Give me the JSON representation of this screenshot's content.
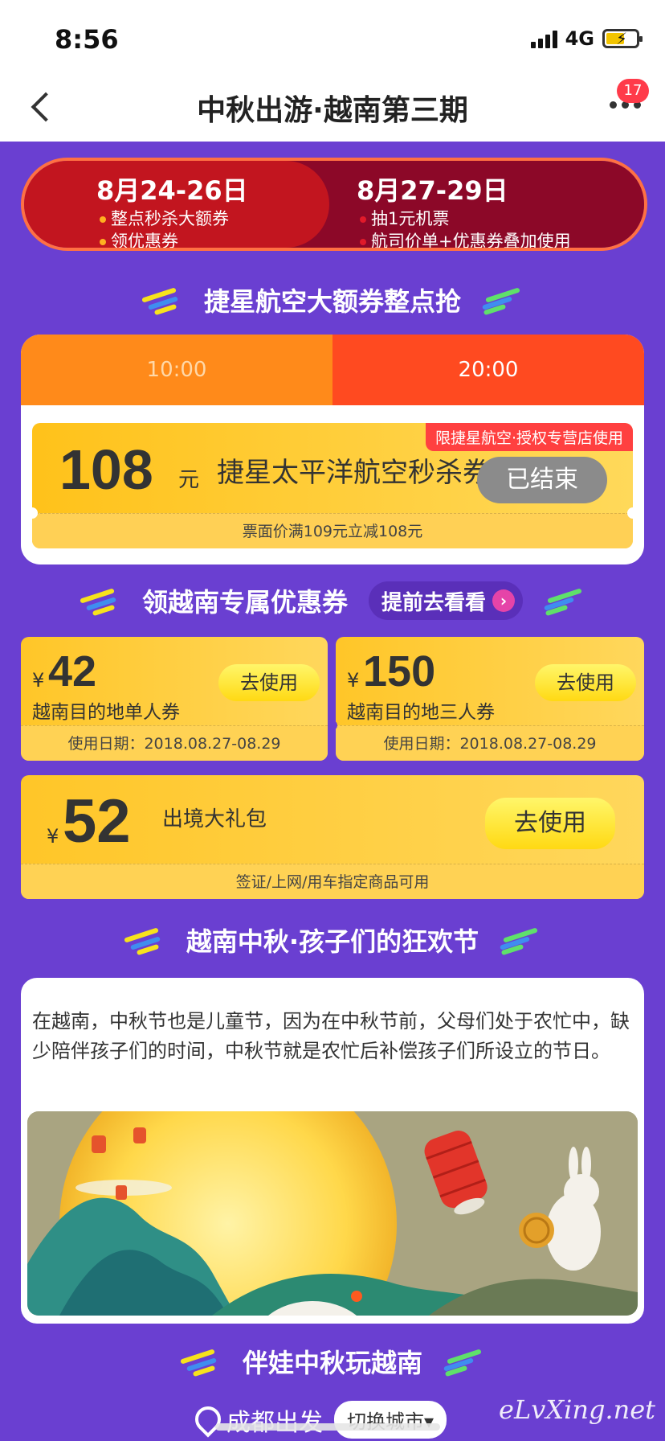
{
  "status_bar": {
    "time": "8:56",
    "network": "4G"
  },
  "nav": {
    "title": "中秋出游·越南第三期",
    "badge_count": "17"
  },
  "phases": [
    {
      "date": "8月24-26日",
      "items": [
        "整点秒杀大额券",
        "领优惠券"
      ],
      "dot_color": "#ffb020"
    },
    {
      "date": "8月27-29日",
      "items": [
        "抽1元机票",
        "航司价单+优惠券叠加使用"
      ],
      "dot_color": "#e11a2a"
    }
  ],
  "section1": {
    "title": "捷星航空大额券整点抢"
  },
  "flash_sale": {
    "tabs": [
      "10:00",
      "20:00"
    ],
    "coupon": {
      "amount": "108",
      "unit": "元",
      "name": "捷星太平洋航空秒杀券",
      "tag": "限捷星航空·授权专营店使用",
      "status_button": "已结束",
      "condition": "票面价满109元立减108元"
    }
  },
  "section2": {
    "title": "领越南专属优惠券",
    "preview_button": "提前去看看"
  },
  "coupons": [
    {
      "currency": "¥",
      "amount": "42",
      "name": "越南目的地单人券",
      "button": "去使用",
      "date": "使用日期：2018.08.27-08.29"
    },
    {
      "currency": "¥",
      "amount": "150",
      "name": "越南目的地三人券",
      "button": "去使用",
      "date": "使用日期：2018.08.27-08.29"
    }
  ],
  "gift_pack": {
    "currency": "¥",
    "amount": "52",
    "name": "出境大礼包",
    "button": "去使用",
    "condition": "签证/上网/用车指定商品可用"
  },
  "section3": {
    "title": "越南中秋·孩子们的狂欢节"
  },
  "story": {
    "text": "在越南，中秋节也是儿童节，因为在中秋节前，父母们处于农忙中，缺少陪伴孩子们的时间，中秋节就是农忙后补偿孩子们所设立的节日。"
  },
  "section4": {
    "title": "伴娃中秋玩越南"
  },
  "location": {
    "city": "成都出发",
    "switch_label": "切换城市▾"
  },
  "watermark": "eLvXing.net",
  "colors": {
    "background": "#6a3fd1",
    "accent_orange": "#ff4a20",
    "coupon_yellow": "#ffc628"
  }
}
